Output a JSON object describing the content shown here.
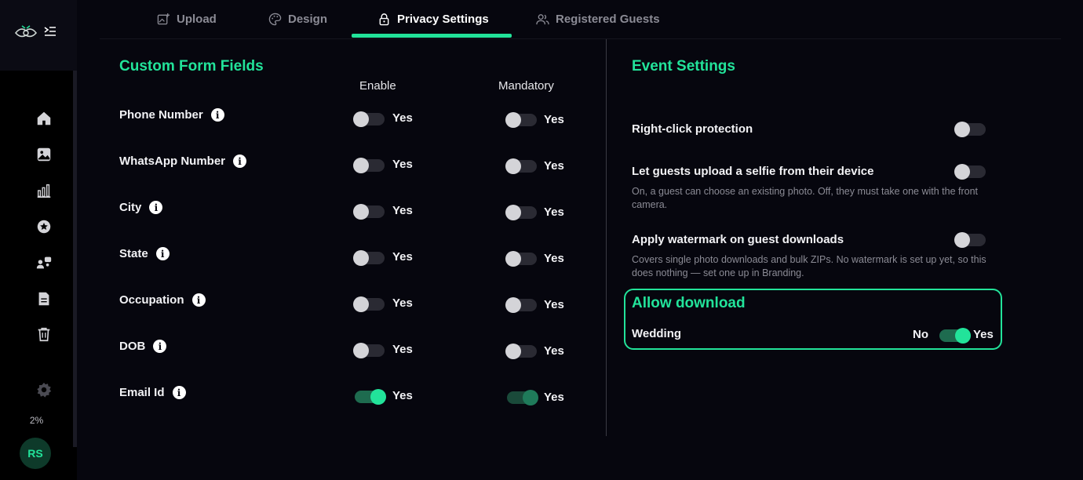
{
  "tabs": [
    {
      "label": "Upload",
      "icon": "image-plus-icon"
    },
    {
      "label": "Design",
      "icon": "palette-icon"
    },
    {
      "label": "Privacy Settings",
      "icon": "lock-icon",
      "active": true
    },
    {
      "label": "Registered Guests",
      "icon": "users-icon"
    }
  ],
  "sidebar": {
    "items": [
      "home-icon",
      "gallery-icon",
      "analytics-icon",
      "star-icon",
      "people-icon",
      "document-icon",
      "trash-icon",
      "settings-icon"
    ],
    "storage": "2%",
    "avatar": "RS"
  },
  "custom_fields": {
    "title": "Custom Form Fields",
    "col_enable": "Enable",
    "col_mandatory": "Mandatory",
    "rows": [
      {
        "label": "Phone Number",
        "enable": false,
        "enable_text": "Yes",
        "mandatory": false,
        "mandatory_text": "Yes"
      },
      {
        "label": "WhatsApp Number",
        "enable": false,
        "enable_text": "Yes",
        "mandatory": false,
        "mandatory_text": "Yes"
      },
      {
        "label": "City",
        "enable": false,
        "enable_text": "Yes",
        "mandatory": false,
        "mandatory_text": "Yes"
      },
      {
        "label": "State",
        "enable": false,
        "enable_text": "Yes",
        "mandatory": false,
        "mandatory_text": "Yes"
      },
      {
        "label": "Occupation",
        "enable": false,
        "enable_text": "Yes",
        "mandatory": false,
        "mandatory_text": "Yes"
      },
      {
        "label": "DOB",
        "enable": false,
        "enable_text": "Yes",
        "mandatory": false,
        "mandatory_text": "Yes"
      },
      {
        "label": "Email Id",
        "enable": true,
        "enable_text": "Yes",
        "mandatory": true,
        "mandatory_text": "Yes"
      }
    ]
  },
  "event_settings": {
    "title": "Event Settings",
    "items": [
      {
        "label": "Right-click protection",
        "enabled": false
      },
      {
        "label": "Let guests upload a selfie from their device",
        "enabled": false,
        "desc": "On, a guest can choose an existing photo. Off, they must take one with the front camera."
      },
      {
        "label": "Apply watermark on guest downloads",
        "enabled": false,
        "desc": "Covers single photo downloads and bulk ZIPs. No watermark is set up yet, so this does nothing — set one up in Branding."
      }
    ],
    "allow_download": {
      "title": "Allow download",
      "label": "Wedding",
      "no": "No",
      "yes": "Yes",
      "enabled": true
    }
  },
  "colors": {
    "accent": "#22e39a",
    "background": "#06060e",
    "sidebar": "#000000"
  }
}
